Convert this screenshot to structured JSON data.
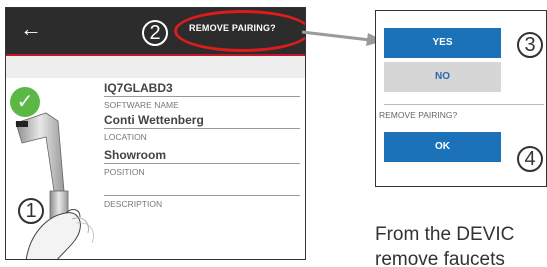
{
  "phone": {
    "remove_pairing_label": "REMOVE PAIRING?",
    "step_2": "2",
    "step_1": "1",
    "fields": [
      {
        "value": "IQ7GLABD3",
        "label": "SOFTWARE NAME"
      },
      {
        "value": "Conti Wettenberg",
        "label": "LOCATION"
      },
      {
        "value": "Showroom",
        "label": "POSITION"
      },
      {
        "value": "",
        "label": "DESCRIPTION"
      }
    ]
  },
  "dialog": {
    "yes_label": "YES",
    "no_label": "NO",
    "remove_pairing_label": "REMOVE PAIRING?",
    "ok_label": "OK",
    "step_3": "3",
    "step_4": "4"
  },
  "description_text": {
    "line1": "From the DEVIC",
    "line2": "remove faucets"
  },
  "colors": {
    "topbar": "#2c2c2c",
    "accent_red": "#c0152a",
    "highlight_ellipse": "#e01b1b",
    "primary_blue": "#1b72b8",
    "success_green": "#5bb845"
  }
}
